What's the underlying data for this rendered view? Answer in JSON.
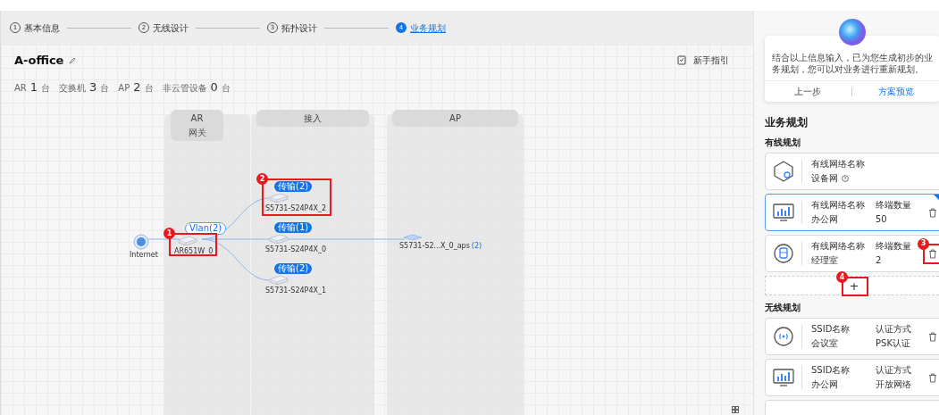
{
  "steps": [
    {
      "number": "1",
      "label": "基本信息",
      "selected": false
    },
    {
      "number": "2",
      "label": "无线设计",
      "selected": false
    },
    {
      "number": "3",
      "label": "拓扑设计",
      "selected": false
    },
    {
      "number": "4",
      "label": "业务规划",
      "selected": true
    }
  ],
  "project": {
    "title": "A-office",
    "guide": "新手指引",
    "counts": [
      {
        "label": "AR",
        "value": "1",
        "unit": "台"
      },
      {
        "label": "交换机",
        "value": "3",
        "unit": "台"
      },
      {
        "label": "AP",
        "value": "2",
        "unit": "台"
      },
      {
        "label": "非云管设备",
        "value": "0",
        "unit": "台"
      }
    ]
  },
  "lanes": [
    {
      "title": "AR",
      "subtitle": "网关"
    },
    {
      "title": "接入"
    },
    {
      "title": "AP"
    }
  ],
  "nodes": [
    {
      "kind": "internet",
      "label": "Internet"
    },
    {
      "kind": "router",
      "label": "AR651W_0",
      "badge": "Vlan(2)"
    },
    {
      "kind": "switch",
      "label": "S5731-S24P4X_2",
      "badge": "传输(2)"
    },
    {
      "kind": "switch",
      "label": "S5731-S24P4X_0",
      "badge": "传输(1)"
    },
    {
      "kind": "switch",
      "label": "S5731-S24P4X_1",
      "badge": "传输(2)"
    },
    {
      "kind": "ap",
      "label": "S5731-S2...X_0_aps",
      "count": "(2)"
    }
  ],
  "annotations": [
    "1",
    "2",
    "3",
    "4"
  ],
  "assistant": {
    "message": "结合以上信息输入，已为您生成初步的业务规划，您可以对业务进行重新规划。",
    "back": "上一步",
    "preview": "方案预览"
  },
  "plan": {
    "title": "业务规划",
    "wired": {
      "title": "有线规划",
      "items": [
        {
          "kind": "device",
          "name_label": "有线网络名称",
          "name": "设备网",
          "help": true,
          "selected": false
        },
        {
          "kind": "office",
          "name_label": "有线网络名称",
          "name": "办公网",
          "count_label": "终端数量",
          "count": "50",
          "selected": true
        },
        {
          "kind": "manager",
          "name_label": "有线网络名称",
          "name": "经理室",
          "count_label": "终端数量",
          "count": "2",
          "selected": false
        }
      ],
      "add": "+"
    },
    "wireless": {
      "title": "无线规划",
      "items": [
        {
          "kind": "wifi",
          "name_label": "SSID名称",
          "name": "会议室",
          "auth_label": "认证方式",
          "auth": "PSK认证"
        },
        {
          "kind": "office",
          "name_label": "SSID名称",
          "name": "办公网",
          "auth_label": "认证方式",
          "auth": "开放网络"
        },
        {
          "kind": "partial"
        }
      ]
    }
  }
}
